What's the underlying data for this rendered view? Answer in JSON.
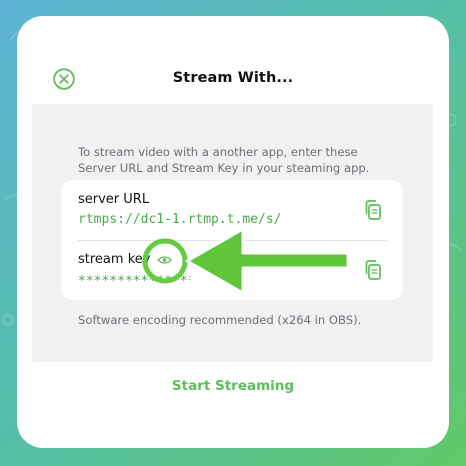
{
  "dialog": {
    "title": "Stream With...",
    "description": "To stream video with a another app, enter these Server URL and Stream Key in your steaming app.",
    "server_url_label": "server URL",
    "server_url_value": "rtmps://dc1-1.rtmp.t.me/s/",
    "stream_key_label": "stream key",
    "stream_key_value": "***************",
    "note": "Software encoding recommended (x264 in OBS).",
    "start_button": "Start Streaming"
  },
  "colors": {
    "accent_green": "#5cbf58",
    "text_green": "#4aa84a",
    "background_gray": "#f1f1f4"
  },
  "icons": {
    "close": "close-icon",
    "copy_url": "copy-icon",
    "copy_key": "copy-icon",
    "eye": "eye-icon"
  }
}
